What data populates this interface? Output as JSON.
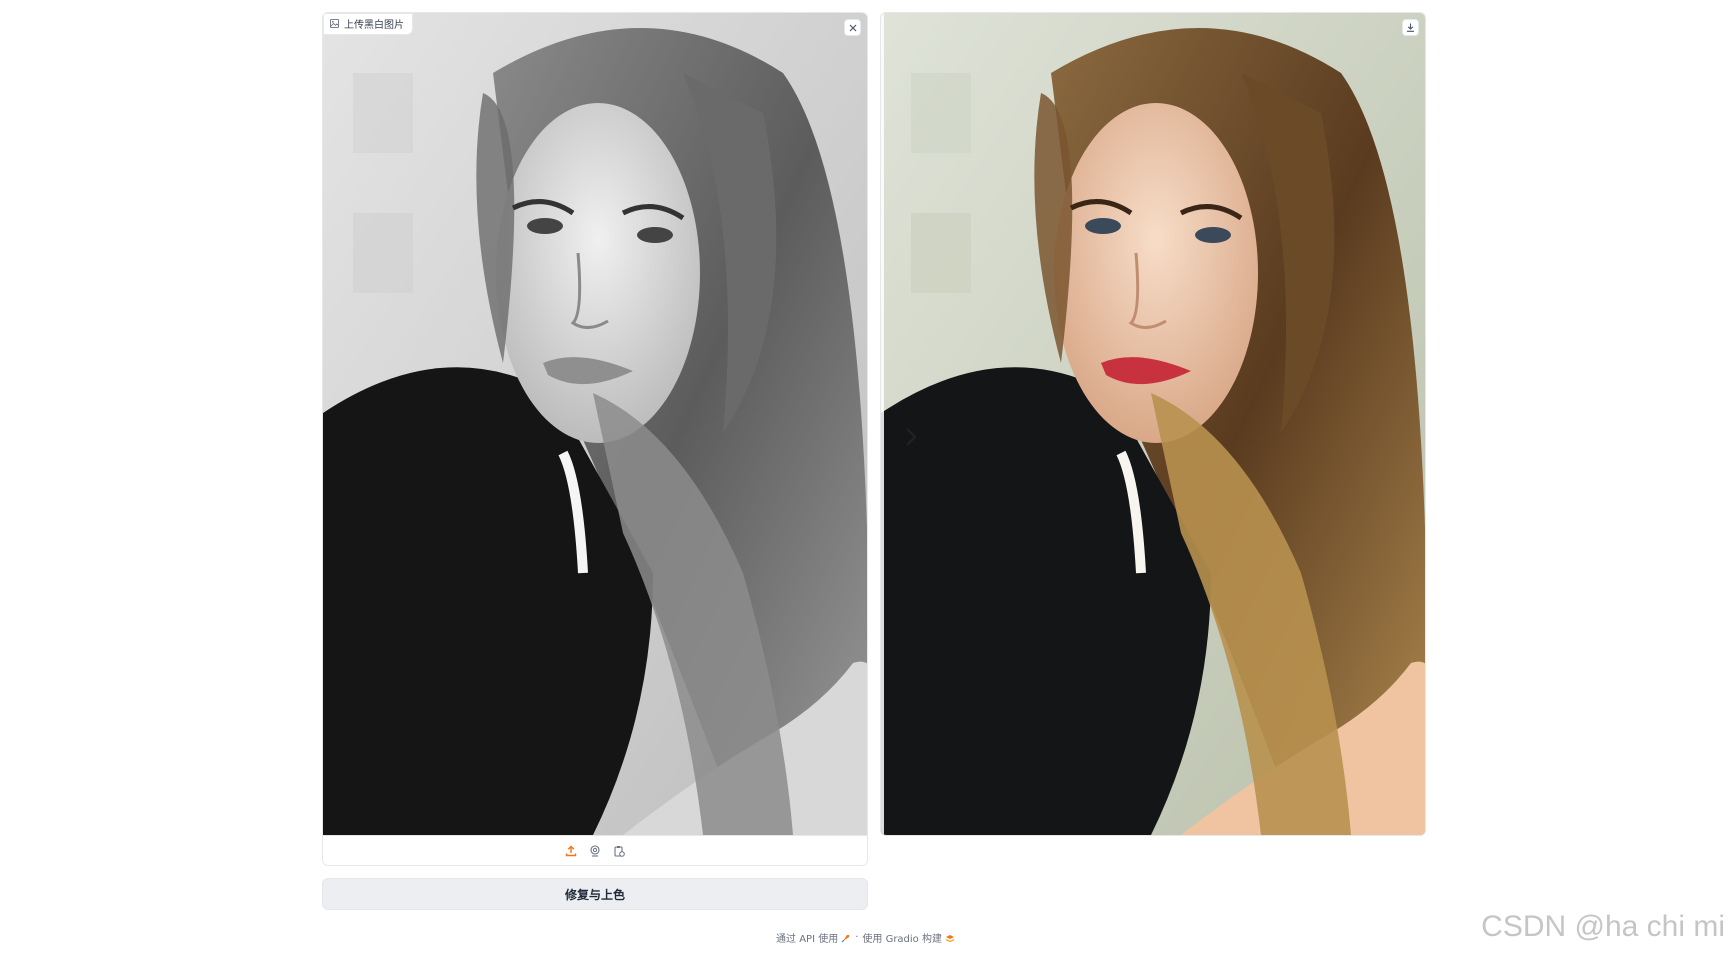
{
  "input": {
    "label": "上传黑白图片",
    "image_alt": "Black and white portrait of a young woman with long hair and a dark coat",
    "clear_icon": "close-icon",
    "sources": [
      "upload-icon",
      "webcam-icon",
      "clipboard-icon"
    ]
  },
  "output": {
    "image_alt": "Colorized portrait of a young woman with long brown hair and a dark coat",
    "download_icon": "download-icon",
    "slider_icon": "chevron-right-icon"
  },
  "run_button": {
    "label": "修复与上色"
  },
  "footer": {
    "api_label": "通过 API 使用",
    "separator": "·",
    "built_label": "使用 Gradio 构建"
  },
  "watermark": "CSDN @ha chi mi",
  "colors": {
    "accent": "#f97316",
    "border": "#e5e7eb",
    "button_bg": "#eceef1"
  }
}
